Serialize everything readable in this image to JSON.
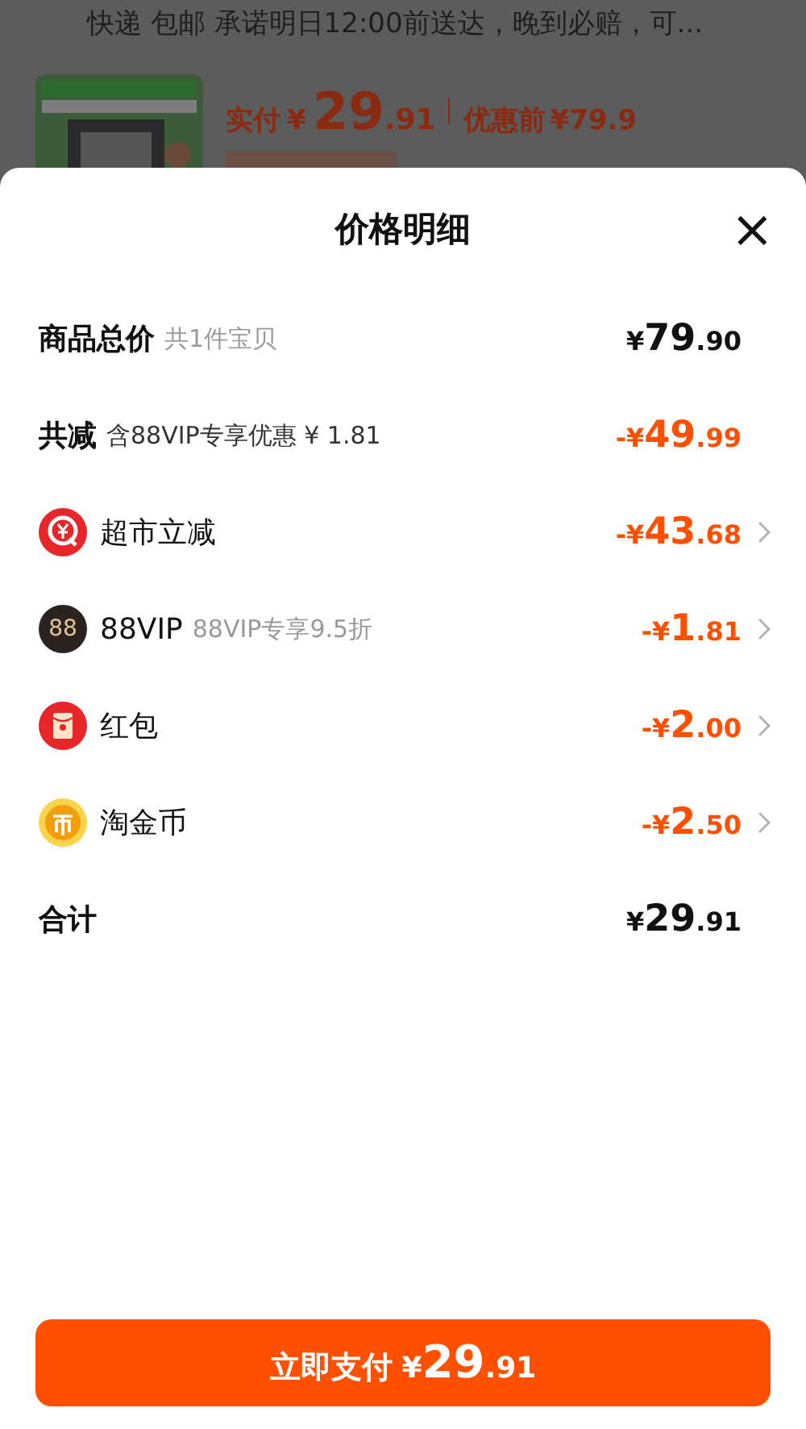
{
  "background": {
    "delivery_text": "快递 包邮 承诺明日12:00前送达，晚到必赔，可...",
    "product": {
      "paid_label": "实付",
      "paid_price": {
        "sign": "¥",
        "whole": "29",
        "fraction": ".91"
      },
      "original_label": "优惠前",
      "original_price": "¥79.9"
    }
  },
  "sheet": {
    "title": "价格明细",
    "close": "×",
    "rows": [
      {
        "kind": "summary",
        "label": "商品总价",
        "note": "共1件宝贝",
        "price": {
          "sign": "¥",
          "whole": "79",
          "fraction": ".90"
        },
        "highlight": false
      },
      {
        "kind": "summary",
        "label": "共减",
        "note": "含88VIP专享优惠 ¥ 1.81",
        "price": {
          "sign": "-¥",
          "whole": "49",
          "fraction": ".99"
        },
        "highlight": true
      },
      {
        "kind": "discount",
        "label": "超市立减",
        "price": {
          "sign": "-¥",
          "whole": "43",
          "fraction": ".68"
        },
        "highlight": true
      },
      {
        "kind": "discount",
        "badge": "88",
        "label": "88VIP",
        "note": "88VIP专享9.5折",
        "price": {
          "sign": "-¥",
          "whole": "1",
          "fraction": ".81"
        },
        "highlight": true
      },
      {
        "kind": "discount",
        "label": "红包",
        "price": {
          "sign": "-¥",
          "whole": "2",
          "fraction": ".00"
        },
        "highlight": true
      },
      {
        "kind": "discount",
        "label": "淘金币",
        "price": {
          "sign": "-¥",
          "whole": "2",
          "fraction": ".50"
        },
        "highlight": true
      },
      {
        "kind": "total",
        "label": "合计",
        "price": {
          "sign": "¥",
          "whole": "29",
          "fraction": ".91"
        },
        "highlight": false
      }
    ],
    "pay_button": {
      "label": "立即支付",
      "price": {
        "sign": "¥",
        "whole": "29",
        "fraction": ".91"
      }
    }
  }
}
